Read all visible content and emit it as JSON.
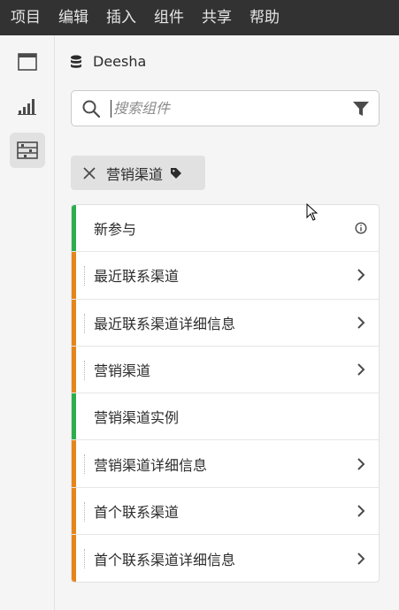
{
  "menubar": {
    "items": [
      "项目",
      "编辑",
      "插入",
      "组件",
      "共享",
      "帮助"
    ]
  },
  "rail": {
    "buttons": [
      {
        "icon": "panel-icon",
        "active": false
      },
      {
        "icon": "bar-chart-icon",
        "active": false
      },
      {
        "icon": "components-icon",
        "active": true
      }
    ]
  },
  "datasource": {
    "icon": "database-icon",
    "name": "Deesha"
  },
  "search": {
    "placeholder": "搜索组件",
    "value": ""
  },
  "filter_tag": {
    "label": "营销渠道"
  },
  "list": {
    "items": [
      {
        "label": "新参与",
        "color": "#2dae4c",
        "end_icon": "info-icon",
        "nested": false
      },
      {
        "label": "最近联系渠道",
        "color": "#e68619",
        "end_icon": "chevron-right-icon",
        "nested": true
      },
      {
        "label": "最近联系渠道详细信息",
        "color": "#e68619",
        "end_icon": "chevron-right-icon",
        "nested": true
      },
      {
        "label": "营销渠道",
        "color": "#e68619",
        "end_icon": "chevron-right-icon",
        "nested": true
      },
      {
        "label": "营销渠道实例",
        "color": "#2dae4c",
        "end_icon": "",
        "nested": false
      },
      {
        "label": "营销渠道详细信息",
        "color": "#e68619",
        "end_icon": "chevron-right-icon",
        "nested": true
      },
      {
        "label": "首个联系渠道",
        "color": "#e68619",
        "end_icon": "chevron-right-icon",
        "nested": true
      },
      {
        "label": "首个联系渠道详细信息",
        "color": "#e68619",
        "end_icon": "chevron-right-icon",
        "nested": true
      }
    ]
  }
}
